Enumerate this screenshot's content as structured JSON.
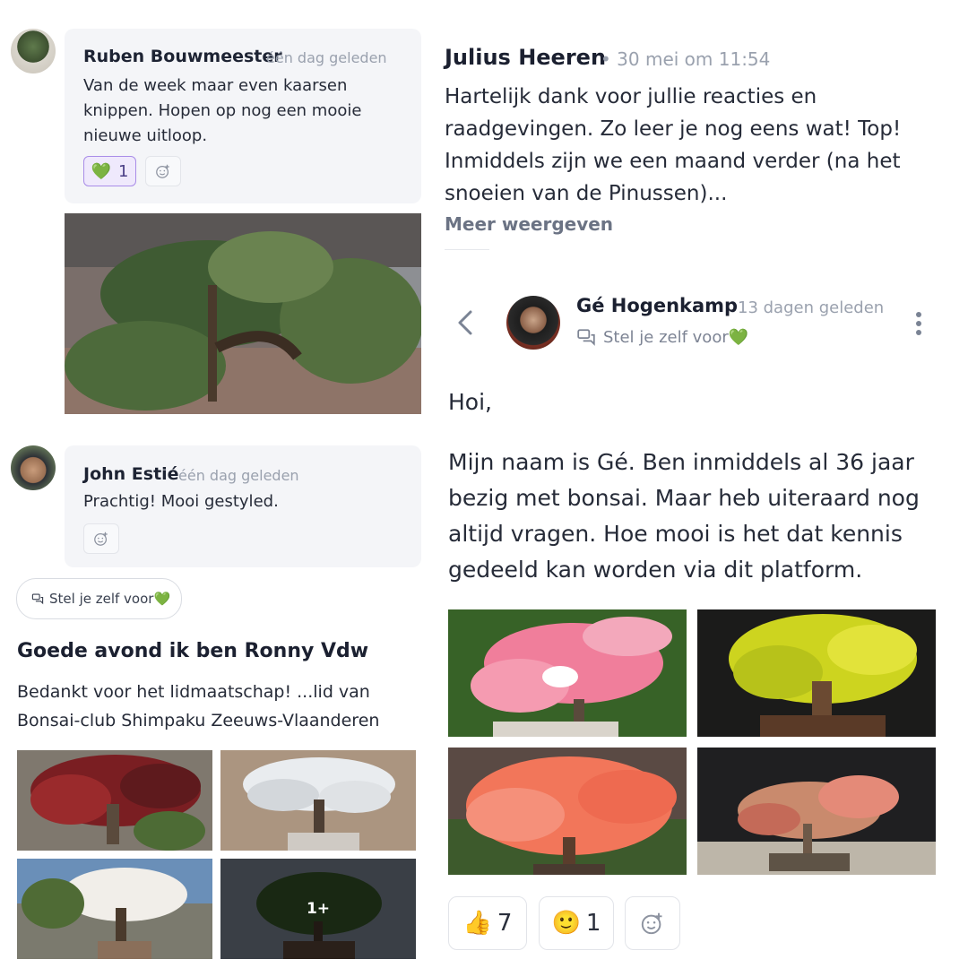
{
  "left": {
    "comment1": {
      "author": "Ruben Bouwmeester",
      "time": "één dag geleden",
      "text": "Van de week maar even kaarsen knippen. Hopen op nog een mooie nieuwe uitloop.",
      "reaction": {
        "emoji": "💚",
        "count": "1"
      }
    },
    "comment2": {
      "author": "John Estié",
      "time": "één dag geleden",
      "text": "Prachtig! Mooi gestyled."
    },
    "tag_pill": "Stel je zelf voor💚",
    "post": {
      "title": "Goede avond ik ben Ronny Vdw",
      "text": "Bedankt voor het lidmaatschap! ...lid van Bonsai-club Shimpaku Zeeuws-Vlaanderen",
      "more_count": "1+"
    }
  },
  "right": {
    "julius": {
      "author": "Julius Heeren",
      "time": "• 30 mei om 11:54",
      "text": "Hartelijk dank voor jullie reacties en raadgevingen. Zo leer je nog eens wat! Top! Inmiddels zijn we een maand verder (na het snoeien van de Pinussen)...",
      "more_label": "Meer weergeven"
    },
    "ge": {
      "author": "Gé Hogenkamp",
      "time": "13 dagen geleden",
      "tag": "Stel je zelf voor💚",
      "greeting": "Hoi,",
      "text": "Mijn naam is Gé. Ben inmiddels al 36 jaar bezig met bonsai. Maar heb uiteraard nog altijd vragen. Hoe mooi is het dat kennis gedeeld kan worden via dit platform.",
      "reactions": [
        {
          "emoji": "👍",
          "count": "7"
        },
        {
          "emoji": "🙂",
          "count": "1"
        }
      ]
    }
  },
  "icons": {
    "back": "chevron-left-icon",
    "more": "kebab-menu-icon",
    "add_reaction": "smiley-plus-icon",
    "topic": "chat-bubbles-icon"
  },
  "colors": {
    "reaction_accent": "#a98de8",
    "muted_text": "#9aa1ae",
    "bubble_bg": "#f4f5f8"
  }
}
